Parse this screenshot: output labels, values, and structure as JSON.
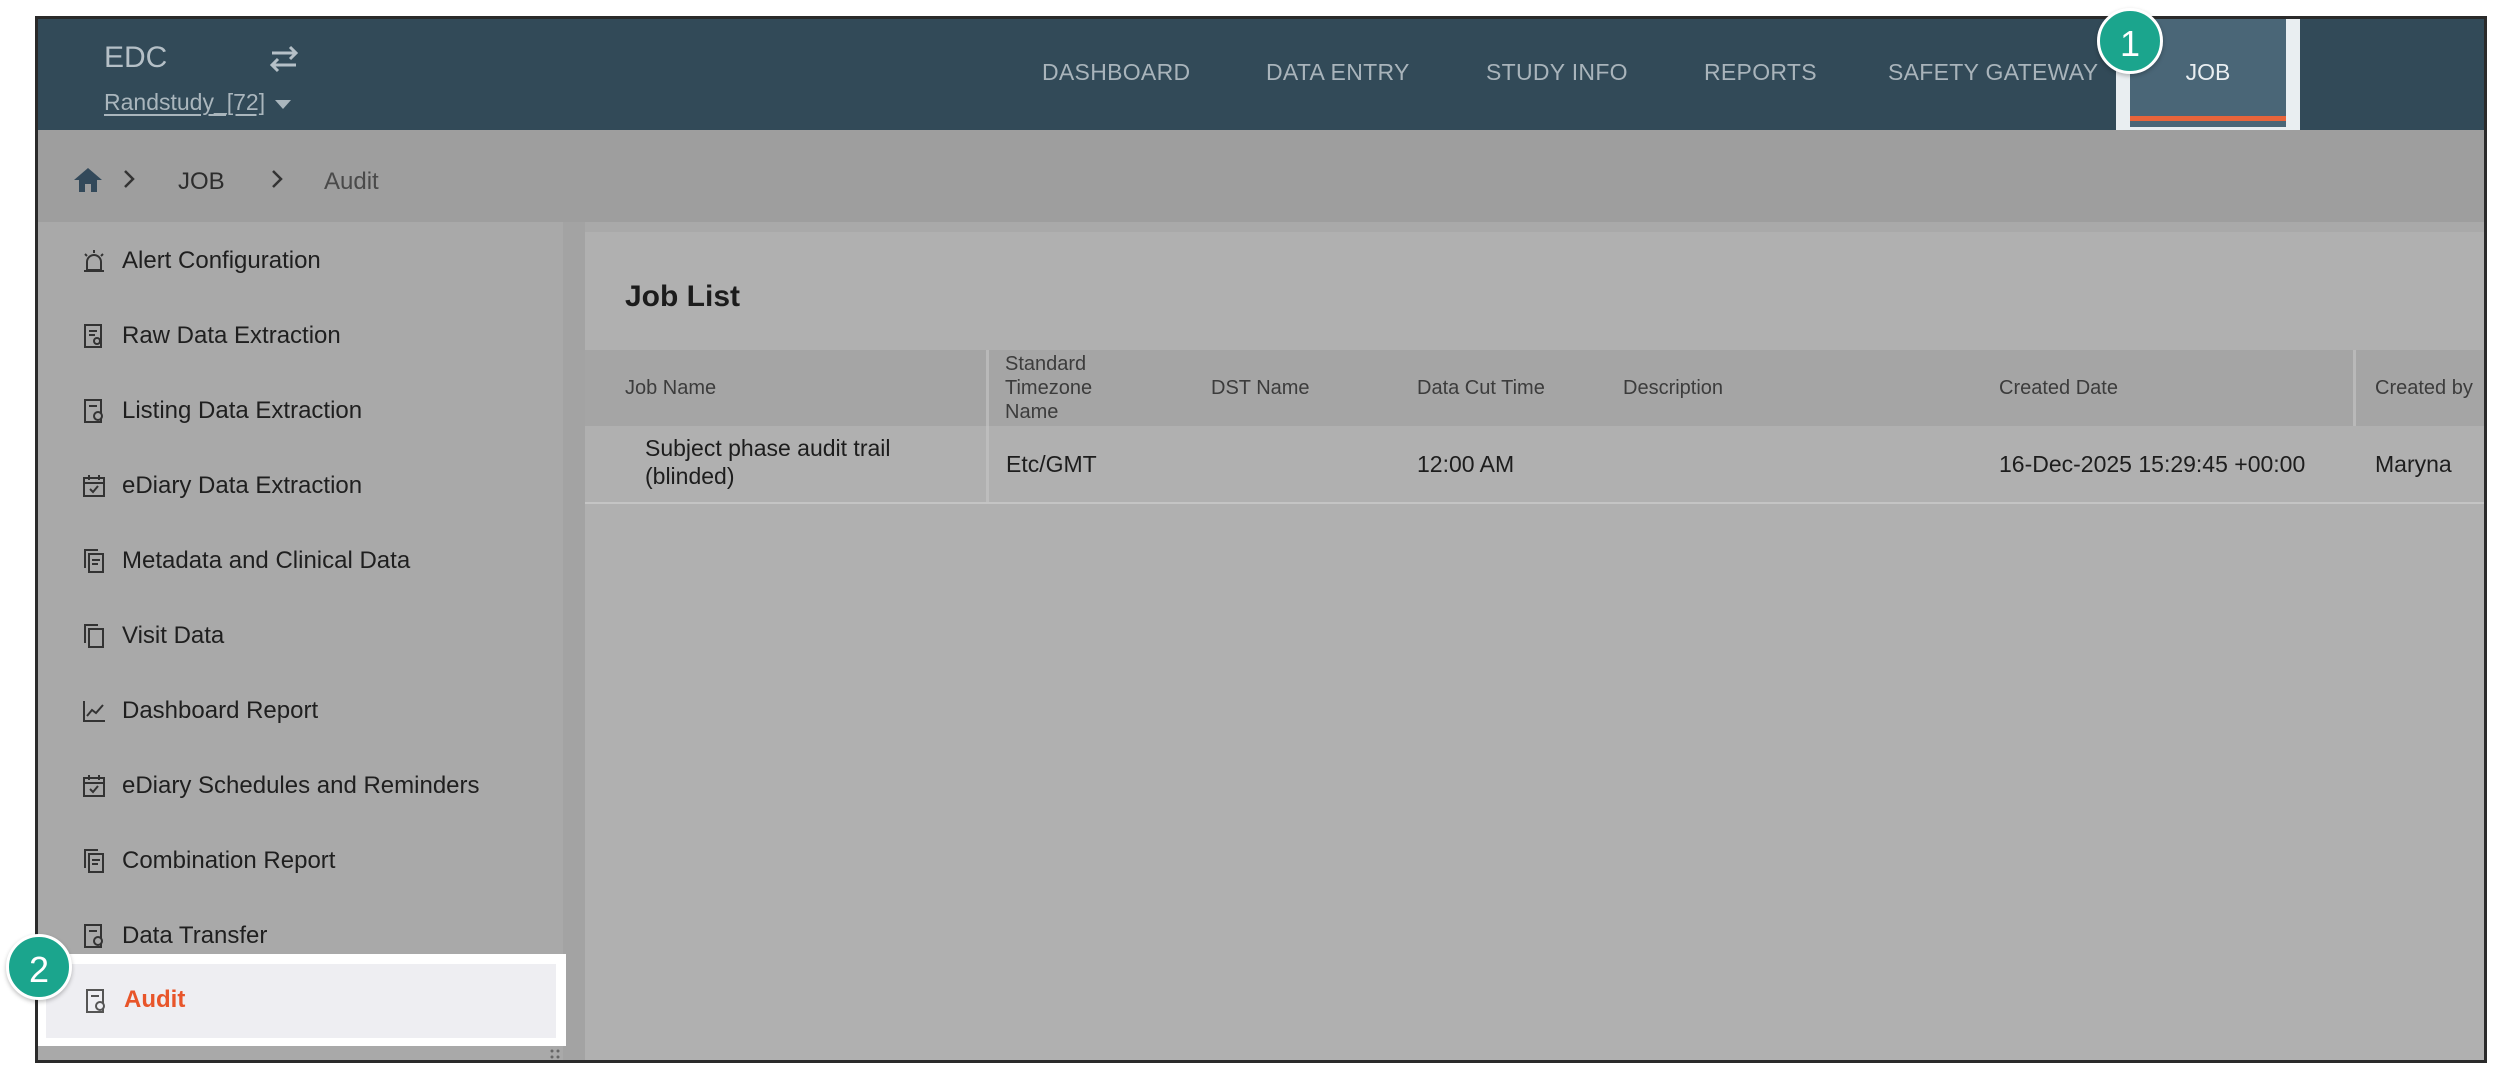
{
  "header": {
    "brand": "EDC",
    "study": "Randstudy_[72]",
    "nav": [
      {
        "label": "DASHBOARD"
      },
      {
        "label": "DATA ENTRY"
      },
      {
        "label": "STUDY INFO"
      },
      {
        "label": "REPORTS"
      },
      {
        "label": "SAFETY GATEWAY"
      },
      {
        "label": "JOB"
      }
    ]
  },
  "badges": [
    "1",
    "2"
  ],
  "breadcrumb": [
    "JOB",
    "Audit"
  ],
  "sidebar": {
    "items": [
      {
        "label": "Alert Configuration",
        "icon": "alarm-icon"
      },
      {
        "label": "Raw Data Extraction",
        "icon": "document-search-icon"
      },
      {
        "label": "Listing Data Extraction",
        "icon": "document-clock-icon"
      },
      {
        "label": "eDiary Data Extraction",
        "icon": "calendar-check-icon"
      },
      {
        "label": "Metadata and Clinical Data",
        "icon": "copy-document-icon"
      },
      {
        "label": "Visit Data",
        "icon": "copy-icon"
      },
      {
        "label": "Dashboard Report",
        "icon": "line-chart-icon"
      },
      {
        "label": "eDiary Schedules and Reminders",
        "icon": "calendar-check-icon"
      },
      {
        "label": "Combination Report",
        "icon": "copy-document-icon"
      },
      {
        "label": "Data Transfer",
        "icon": "document-clock-icon"
      },
      {
        "label": "Audit",
        "icon": "document-clock-icon"
      }
    ]
  },
  "main": {
    "title": "Job List",
    "columns": [
      "Job Name",
      "Standard Timezone Name",
      "DST Name",
      "Data Cut Time",
      "Description",
      "Created Date",
      "Created by"
    ],
    "rows": [
      {
        "job_name": "Subject phase audit trail (blinded)",
        "timezone": "Etc/GMT",
        "dst_name": "",
        "data_cut_time": "12:00 AM",
        "description": "",
        "created_date": "16-Dec-2025 15:29:45 +00:00",
        "created_by": "Maryna"
      }
    ]
  },
  "colors": {
    "topbar": "#324a58",
    "accent": "#e8643a",
    "badge": "#1ba58d",
    "active_text": "#e8552a"
  }
}
